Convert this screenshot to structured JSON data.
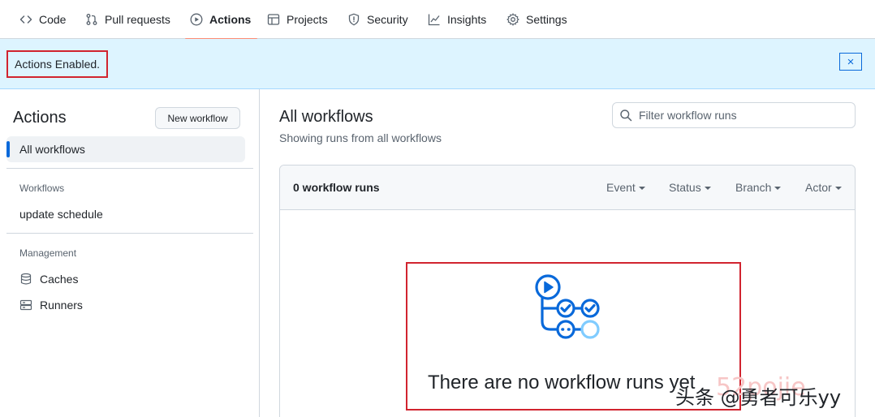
{
  "nav": {
    "tabs": [
      {
        "label": "Code",
        "icon": "code-icon"
      },
      {
        "label": "Pull requests",
        "icon": "pull-request-icon"
      },
      {
        "label": "Actions",
        "icon": "play-icon",
        "active": true
      },
      {
        "label": "Projects",
        "icon": "table-icon"
      },
      {
        "label": "Security",
        "icon": "shield-icon"
      },
      {
        "label": "Insights",
        "icon": "graph-icon"
      },
      {
        "label": "Settings",
        "icon": "gear-icon"
      }
    ]
  },
  "flash": {
    "message": "Actions Enabled.",
    "close_symbol": "×"
  },
  "sidebar": {
    "title": "Actions",
    "new_workflow_label": "New workflow",
    "active_item": "All workflows",
    "workflows_heading": "Workflows",
    "workflows": [
      "update schedule"
    ],
    "management_heading": "Management",
    "management_items": [
      {
        "label": "Caches",
        "icon": "database-icon"
      },
      {
        "label": "Runners",
        "icon": "server-icon"
      }
    ]
  },
  "main": {
    "title": "All workflows",
    "subtitle": "Showing runs from all workflows",
    "filter_placeholder": "Filter workflow runs",
    "run_count": "0 workflow runs",
    "filters": [
      "Event",
      "Status",
      "Branch",
      "Actor"
    ],
    "blank_title": "There are no workflow runs yet"
  },
  "watermark": {
    "text": "头条 @勇者可乐yy",
    "faint_text": "52pojie"
  },
  "colors": {
    "accent": "#0969da",
    "tab_underline": "#fd8c73",
    "flash_bg": "#ddf4ff",
    "highlight_frame": "#d1242f",
    "blank_icon": "#0969da"
  }
}
